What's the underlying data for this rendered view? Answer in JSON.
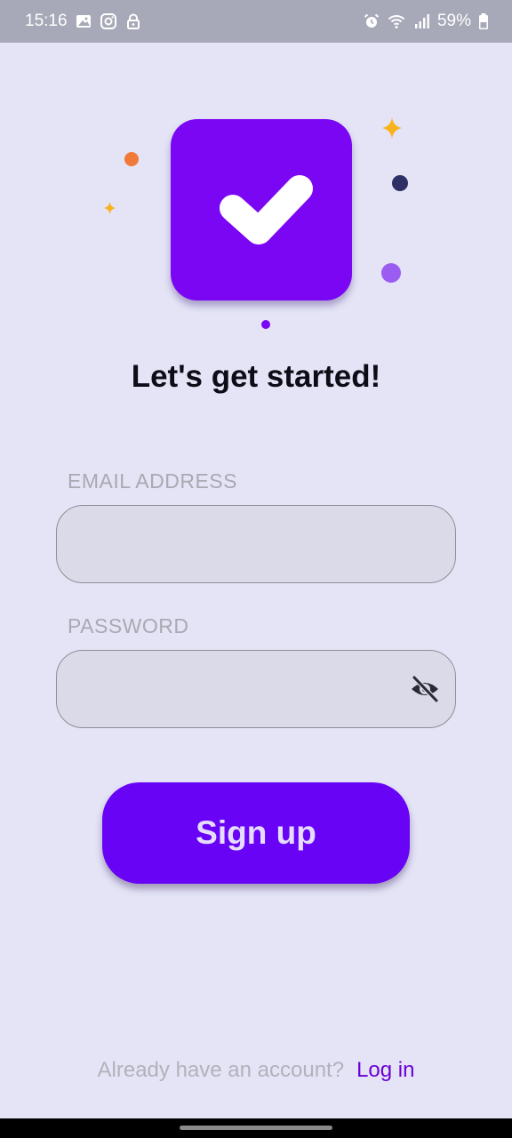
{
  "status_bar": {
    "time": "15:16",
    "battery": "59%",
    "left_icons": [
      "gallery-icon",
      "instagram-icon",
      "lock-icon"
    ],
    "right_icons": [
      "alarm-icon",
      "wifi-icon",
      "signal-icon",
      "battery-icon"
    ]
  },
  "hero": {
    "logo_icon": "check-mark-icon",
    "colors": {
      "tile": "#7b06f4",
      "orange_dot": "#f07a3a",
      "navy_dot": "#2d2f66",
      "lavender_dot": "#9b5cf2",
      "purple_dot": "#7b06f4",
      "spark": "#f8b21c"
    }
  },
  "title": "Let's get started!",
  "form": {
    "email": {
      "label": "EMAIL ADDRESS",
      "value": "",
      "placeholder": ""
    },
    "password": {
      "label": "PASSWORD",
      "value": "",
      "placeholder": "",
      "toggle_icon": "eye-off-icon"
    }
  },
  "signup_button": "Sign up",
  "footer": {
    "prompt": "Already have an account?",
    "login_link": "Log in"
  },
  "theme": {
    "background": "#e4e4f6",
    "accent": "#6803f6",
    "link": "#6b00d6"
  }
}
